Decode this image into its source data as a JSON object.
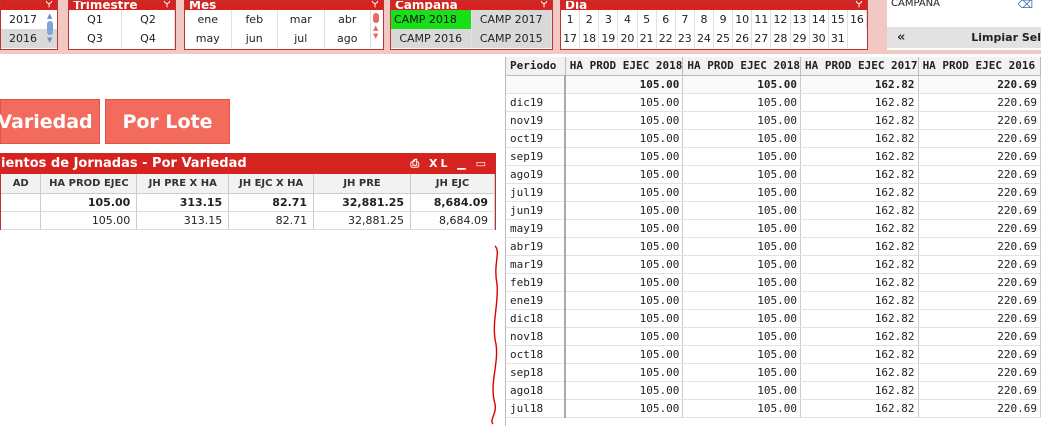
{
  "filters": {
    "anio": {
      "title": "",
      "values": [
        "2017",
        "2016"
      ]
    },
    "trimestre": {
      "title": "Trimestre",
      "values": [
        "Q1",
        "Q2",
        "Q3",
        "Q4"
      ]
    },
    "mes": {
      "title": "Mes",
      "values": [
        "ene",
        "feb",
        "mar",
        "abr",
        "may",
        "jun",
        "jul",
        "ago"
      ]
    },
    "campana": {
      "title": "Campaña",
      "values": [
        "CAMP 2018",
        "CAMP 2017",
        "CAMP 2016",
        "CAMP 2015"
      ],
      "selected": "CAMP 2018"
    },
    "dia": {
      "title": "Día",
      "values": [
        "1",
        "2",
        "3",
        "4",
        "5",
        "6",
        "7",
        "8",
        "9",
        "10",
        "11",
        "12",
        "13",
        "14",
        "15",
        "16",
        "17",
        "18",
        "19",
        "20",
        "21",
        "22",
        "23",
        "24",
        "25",
        "26",
        "27",
        "28",
        "29",
        "30",
        "31"
      ]
    }
  },
  "selection_panel": {
    "label": "CAMPAÑA",
    "clear_label": "Limpiar Sel",
    "back_arrow": "«"
  },
  "buttons": {
    "variedad": "Variedad",
    "lote": "Por Lote"
  },
  "jornadas": {
    "title": "ientos de Jornadas - Por Variedad",
    "controls": "⎙ XL ▁ ▭",
    "columns": [
      "AD",
      "HA PROD EJEC",
      "JH PRE X HA",
      "JH EJC X HA",
      "JH PRE",
      "JH EJC"
    ],
    "total": [
      "",
      "105.00",
      "313.15",
      "82.71",
      "32,881.25",
      "8,684.09"
    ],
    "rows": [
      [
        "",
        "105.00",
        "313.15",
        "82.71",
        "32,881.25",
        "8,684.09"
      ]
    ]
  },
  "periodo_table": {
    "columns": [
      "Periodo",
      "HA PROD EJEC 2018",
      "HA PROD EJEC 2018",
      "HA PROD EJEC 2017",
      "HA PROD EJEC 2016"
    ],
    "total": [
      "",
      "105.00",
      "105.00",
      "162.82",
      "220.69"
    ],
    "rows": [
      [
        "dic19",
        "105.00",
        "105.00",
        "162.82",
        "220.69"
      ],
      [
        "nov19",
        "105.00",
        "105.00",
        "162.82",
        "220.69"
      ],
      [
        "oct19",
        "105.00",
        "105.00",
        "162.82",
        "220.69"
      ],
      [
        "sep19",
        "105.00",
        "105.00",
        "162.82",
        "220.69"
      ],
      [
        "ago19",
        "105.00",
        "105.00",
        "162.82",
        "220.69"
      ],
      [
        "jul19",
        "105.00",
        "105.00",
        "162.82",
        "220.69"
      ],
      [
        "jun19",
        "105.00",
        "105.00",
        "162.82",
        "220.69"
      ],
      [
        "may19",
        "105.00",
        "105.00",
        "162.82",
        "220.69"
      ],
      [
        "abr19",
        "105.00",
        "105.00",
        "162.82",
        "220.69"
      ],
      [
        "mar19",
        "105.00",
        "105.00",
        "162.82",
        "220.69"
      ],
      [
        "feb19",
        "105.00",
        "105.00",
        "162.82",
        "220.69"
      ],
      [
        "ene19",
        "105.00",
        "105.00",
        "162.82",
        "220.69"
      ],
      [
        "dic18",
        "105.00",
        "105.00",
        "162.82",
        "220.69"
      ],
      [
        "nov18",
        "105.00",
        "105.00",
        "162.82",
        "220.69"
      ],
      [
        "oct18",
        "105.00",
        "105.00",
        "162.82",
        "220.69"
      ],
      [
        "sep18",
        "105.00",
        "105.00",
        "162.82",
        "220.69"
      ],
      [
        "ago18",
        "105.00",
        "105.00",
        "162.82",
        "220.69"
      ],
      [
        "jul18",
        "105.00",
        "105.00",
        "162.82",
        "220.69"
      ]
    ]
  },
  "colors": {
    "accent": "#d6231f",
    "button": "#f26b5c",
    "selected": "#18e018",
    "topbar": "#f2c9c2"
  }
}
